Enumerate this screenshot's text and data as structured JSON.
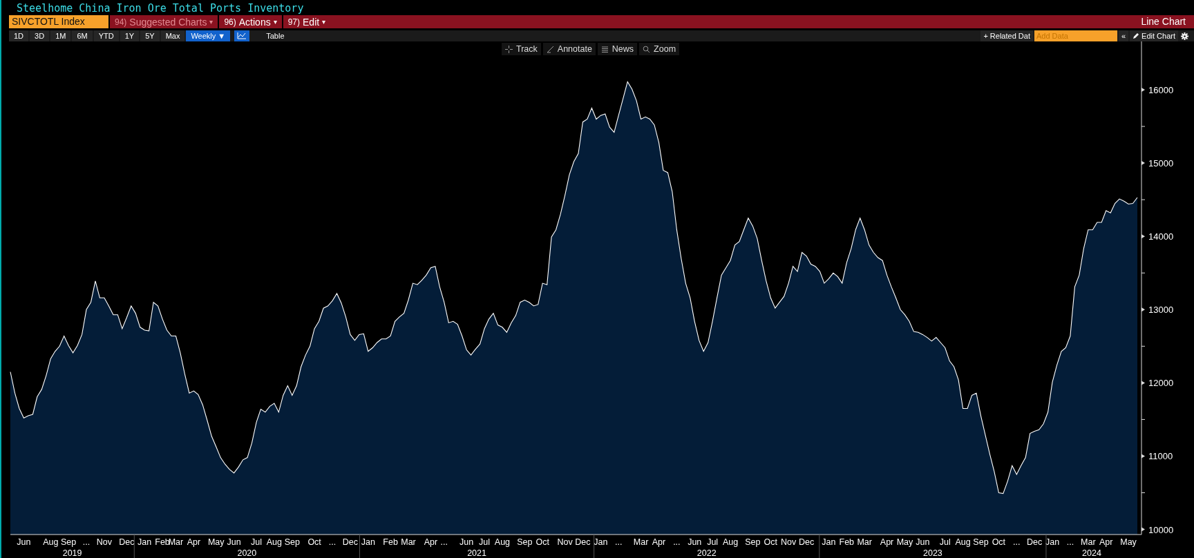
{
  "title": "Steelhome China Iron Ore Total Ports Inventory",
  "toolbar": {
    "ticker": "SIVCTOTL Index",
    "menus": [
      {
        "number": "94)",
        "label": "Suggested Charts",
        "caret": "▾",
        "disabled": true
      },
      {
        "number": "96)",
        "label": "Actions",
        "caret": "▾",
        "disabled": false
      },
      {
        "number": "97)",
        "label": "Edit",
        "caret": "▾",
        "disabled": false
      }
    ],
    "chart_type": "Line Chart"
  },
  "ranges": [
    {
      "label": "1D",
      "selected": false
    },
    {
      "label": "3D",
      "selected": false
    },
    {
      "label": "1M",
      "selected": false
    },
    {
      "label": "6M",
      "selected": false
    },
    {
      "label": "YTD",
      "selected": false
    },
    {
      "label": "1Y",
      "selected": false
    },
    {
      "label": "5Y",
      "selected": false
    },
    {
      "label": "Max",
      "selected": false
    },
    {
      "label": "Weekly ▼",
      "selected": true
    }
  ],
  "views": [
    {
      "kind": "icon",
      "selected": true
    },
    {
      "kind": "text",
      "label": "Table",
      "selected": false
    }
  ],
  "right_tools": {
    "related": "+ Related Dat",
    "add_data": {
      "placeholder": "Add Data"
    },
    "collapse": "«",
    "edit_chart": "Edit Chart"
  },
  "chart_tools": [
    {
      "kind": "crosshair",
      "label": "Track"
    },
    {
      "kind": "pencil",
      "label": "Annotate"
    },
    {
      "kind": "list",
      "label": "News"
    },
    {
      "kind": "search",
      "label": "Zoom"
    }
  ],
  "chart": {
    "chart_data": {
      "type": "area",
      "ylim": [
        9930,
        16660
      ],
      "yticks": [
        10000,
        11000,
        12000,
        13000,
        14000,
        15000,
        16000
      ],
      "categories": [
        null,
        null,
        null,
        "Jun",
        null,
        null,
        null,
        null,
        null,
        "Aug",
        null,
        null,
        null,
        "Sep",
        null,
        null,
        null,
        "...",
        null,
        null,
        null,
        "Nov",
        null,
        null,
        null,
        null,
        "Dec",
        null,
        null,
        null,
        "Jan",
        null,
        null,
        null,
        "Feb",
        null,
        null,
        "Mar",
        null,
        null,
        null,
        "Apr",
        null,
        null,
        null,
        null,
        "May",
        null,
        null,
        null,
        "Jun",
        null,
        null,
        null,
        null,
        "Jul",
        null,
        null,
        null,
        "Aug",
        null,
        null,
        null,
        "Sep",
        null,
        null,
        null,
        null,
        "Oct",
        null,
        null,
        null,
        "...",
        null,
        null,
        null,
        "Dec",
        null,
        null,
        null,
        "Jan",
        null,
        null,
        null,
        null,
        "Feb",
        null,
        null,
        null,
        "Mar",
        null,
        null,
        null,
        null,
        "Apr",
        null,
        null,
        "...",
        null,
        null,
        null,
        null,
        "Jun",
        null,
        null,
        null,
        "Jul",
        null,
        null,
        null,
        "Aug",
        null,
        null,
        null,
        null,
        "Sep",
        null,
        null,
        null,
        "Oct",
        null,
        null,
        null,
        null,
        "Nov",
        null,
        null,
        null,
        "Dec",
        null,
        null,
        null,
        "Jan",
        null,
        null,
        null,
        "...",
        null,
        null,
        null,
        null,
        "Mar",
        null,
        null,
        null,
        "Apr",
        null,
        null,
        null,
        "...",
        null,
        null,
        null,
        "Jun",
        null,
        null,
        null,
        "Jul",
        null,
        null,
        null,
        "Aug",
        null,
        null,
        null,
        null,
        "Sep",
        null,
        null,
        null,
        "Oct",
        null,
        null,
        null,
        "Nov",
        null,
        null,
        null,
        "Dec",
        null,
        null,
        null,
        null,
        "Jan",
        null,
        null,
        null,
        "Feb",
        null,
        null,
        null,
        "Mar",
        null,
        null,
        null,
        null,
        "Apr",
        null,
        null,
        null,
        "May",
        null,
        null,
        null,
        "Jun",
        null,
        null,
        null,
        null,
        "Jul",
        null,
        null,
        null,
        "Aug",
        null,
        null,
        null,
        "Sep",
        null,
        null,
        null,
        "Oct",
        null,
        null,
        null,
        "...",
        null,
        null,
        null,
        "Dec",
        null,
        null,
        null,
        "Jan",
        null,
        null,
        null,
        "...",
        null,
        null,
        null,
        "Mar",
        null,
        null,
        null,
        "Apr",
        null,
        null,
        null,
        null,
        "May",
        null,
        null
      ],
      "annotations": [
        "2019",
        "2020",
        "2021",
        "2022",
        "2023",
        "2024"
      ],
      "values": [
        12150,
        11860,
        11650,
        11520,
        11550,
        11570,
        11810,
        11910,
        12100,
        12330,
        12430,
        12500,
        12640,
        12510,
        12410,
        12510,
        12660,
        13000,
        13100,
        13390,
        13160,
        13160,
        13050,
        12930,
        12930,
        12740,
        12890,
        13050,
        12950,
        12760,
        12720,
        12710,
        13100,
        13050,
        12870,
        12720,
        12640,
        12640,
        12410,
        12120,
        11860,
        11890,
        11840,
        11700,
        11490,
        11270,
        11130,
        10980,
        10890,
        10820,
        10770,
        10850,
        10950,
        10980,
        11180,
        11460,
        11640,
        11600,
        11680,
        11720,
        11600,
        11830,
        11960,
        11830,
        11960,
        12220,
        12380,
        12500,
        12740,
        12840,
        13020,
        13050,
        13120,
        13220,
        13090,
        12900,
        12660,
        12580,
        12660,
        12670,
        12430,
        12480,
        12550,
        12600,
        12600,
        12640,
        12840,
        12900,
        12950,
        13130,
        13360,
        13340,
        13400,
        13470,
        13570,
        13590,
        13310,
        13100,
        12820,
        12840,
        12800,
        12640,
        12450,
        12380,
        12460,
        12530,
        12740,
        12870,
        12950,
        12790,
        12760,
        12690,
        12820,
        12920,
        13100,
        13130,
        13100,
        13050,
        13070,
        13360,
        13340,
        13990,
        14090,
        14300,
        14560,
        14840,
        15020,
        15130,
        15560,
        15600,
        15750,
        15600,
        15650,
        15670,
        15490,
        15420,
        15650,
        15880,
        16110,
        16010,
        15850,
        15600,
        15630,
        15600,
        15520,
        15280,
        14900,
        14870,
        14610,
        14090,
        13700,
        13360,
        13160,
        12840,
        12580,
        12430,
        12550,
        12840,
        13160,
        13470,
        13570,
        13670,
        13880,
        13930,
        14090,
        14250,
        14140,
        13970,
        13670,
        13390,
        13160,
        13020,
        13100,
        13180,
        13360,
        13590,
        13520,
        13780,
        13730,
        13620,
        13590,
        13520,
        13360,
        13420,
        13500,
        13450,
        13360,
        13640,
        13830,
        14090,
        14250,
        14090,
        13880,
        13780,
        13710,
        13670,
        13470,
        13310,
        13160,
        13000,
        12930,
        12840,
        12700,
        12690,
        12660,
        12620,
        12570,
        12620,
        12550,
        12480,
        12300,
        12220,
        12040,
        11650,
        11650,
        11830,
        11860,
        11550,
        11290,
        11030,
        10790,
        10500,
        10490,
        10660,
        10870,
        10750,
        10870,
        10980,
        11310,
        11340,
        11360,
        11440,
        11600,
        12010,
        12240,
        12430,
        12480,
        12640,
        13310,
        13470,
        13830,
        14090,
        14090,
        14190,
        14190,
        14350,
        14320,
        14450,
        14510,
        14480,
        14440,
        14450,
        14530
      ]
    }
  }
}
